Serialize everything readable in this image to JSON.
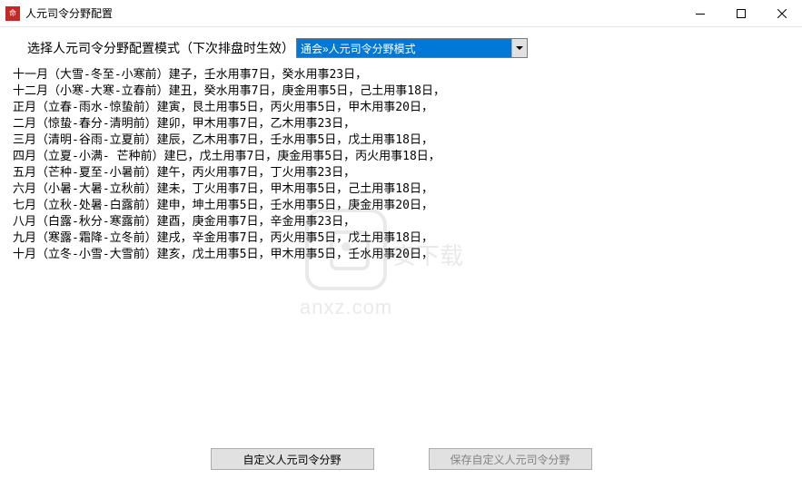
{
  "window": {
    "title": "人元司令分野配置"
  },
  "config": {
    "label": "选择人元司令分野配置模式（下次排盘时生效）",
    "dropdown_value": "通会»人元司令分野模式"
  },
  "lines": [
    "十一月（大雪-冬至-小寒前）建子，壬水用事7日，癸水用事23日，",
    "十二月（小寒-大寒-立春前）建丑，癸水用事7日，庚金用事5日，己土用事18日，",
    "正月（立春-雨水-惊蛰前）建寅，艮土用事5日，丙火用事5日，甲木用事20日，",
    "二月（惊蛰-春分-清明前）建卯，甲木用事7日，乙木用事23日，",
    "三月（清明-谷雨-立夏前）建辰，乙木用事7日，壬水用事5日，戊土用事18日，",
    "四月（立夏-小满- 芒种前）建巳，戊土用事7日，庚金用事5日，丙火用事18日，",
    "五月（芒种-夏至-小暑前）建午，丙火用事7日，丁火用事23日，",
    "六月（小暑-大暑-立秋前）建未，丁火用事7日，甲木用事5日，己土用事18日，",
    "七月（立秋-处暑-白露前）建申，坤土用事5日，壬水用事5日，庚金用事20日，",
    "八月（白露-秋分-寒露前）建酉，庚金用事7日，辛金用事23日，",
    "九月（寒露-霜降-立冬前）建戌，辛金用事7日，丙火用事5日，戊土用事18日，",
    "十月（立冬-小雪-大雪前）建亥，戊土用事5日，甲木用事5日，壬水用事20日，"
  ],
  "buttons": {
    "custom": "自定义人元司令分野",
    "save": "保存自定义人元司令分野"
  },
  "watermark": {
    "domain": "anxz.com",
    "cn": "安下载"
  }
}
